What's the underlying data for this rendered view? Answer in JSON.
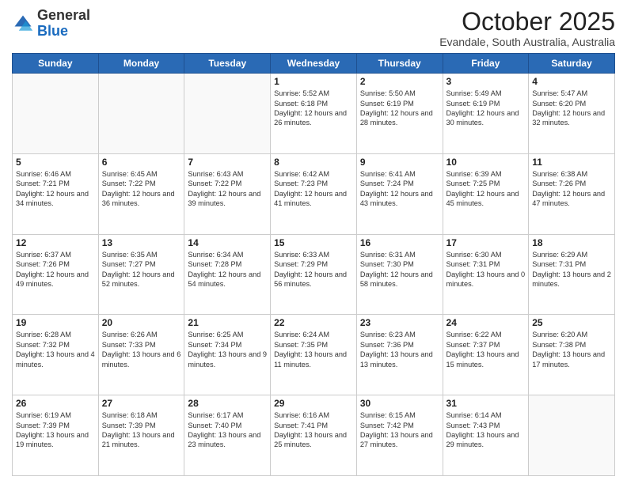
{
  "logo": {
    "general": "General",
    "blue": "Blue"
  },
  "header": {
    "month": "October 2025",
    "location": "Evandale, South Australia, Australia"
  },
  "weekdays": [
    "Sunday",
    "Monday",
    "Tuesday",
    "Wednesday",
    "Thursday",
    "Friday",
    "Saturday"
  ],
  "weeks": [
    [
      {
        "day": "",
        "info": ""
      },
      {
        "day": "",
        "info": ""
      },
      {
        "day": "",
        "info": ""
      },
      {
        "day": "1",
        "info": "Sunrise: 5:52 AM\nSunset: 6:18 PM\nDaylight: 12 hours\nand 26 minutes."
      },
      {
        "day": "2",
        "info": "Sunrise: 5:50 AM\nSunset: 6:19 PM\nDaylight: 12 hours\nand 28 minutes."
      },
      {
        "day": "3",
        "info": "Sunrise: 5:49 AM\nSunset: 6:19 PM\nDaylight: 12 hours\nand 30 minutes."
      },
      {
        "day": "4",
        "info": "Sunrise: 5:47 AM\nSunset: 6:20 PM\nDaylight: 12 hours\nand 32 minutes."
      }
    ],
    [
      {
        "day": "5",
        "info": "Sunrise: 6:46 AM\nSunset: 7:21 PM\nDaylight: 12 hours\nand 34 minutes."
      },
      {
        "day": "6",
        "info": "Sunrise: 6:45 AM\nSunset: 7:22 PM\nDaylight: 12 hours\nand 36 minutes."
      },
      {
        "day": "7",
        "info": "Sunrise: 6:43 AM\nSunset: 7:22 PM\nDaylight: 12 hours\nand 39 minutes."
      },
      {
        "day": "8",
        "info": "Sunrise: 6:42 AM\nSunset: 7:23 PM\nDaylight: 12 hours\nand 41 minutes."
      },
      {
        "day": "9",
        "info": "Sunrise: 6:41 AM\nSunset: 7:24 PM\nDaylight: 12 hours\nand 43 minutes."
      },
      {
        "day": "10",
        "info": "Sunrise: 6:39 AM\nSunset: 7:25 PM\nDaylight: 12 hours\nand 45 minutes."
      },
      {
        "day": "11",
        "info": "Sunrise: 6:38 AM\nSunset: 7:26 PM\nDaylight: 12 hours\nand 47 minutes."
      }
    ],
    [
      {
        "day": "12",
        "info": "Sunrise: 6:37 AM\nSunset: 7:26 PM\nDaylight: 12 hours\nand 49 minutes."
      },
      {
        "day": "13",
        "info": "Sunrise: 6:35 AM\nSunset: 7:27 PM\nDaylight: 12 hours\nand 52 minutes."
      },
      {
        "day": "14",
        "info": "Sunrise: 6:34 AM\nSunset: 7:28 PM\nDaylight: 12 hours\nand 54 minutes."
      },
      {
        "day": "15",
        "info": "Sunrise: 6:33 AM\nSunset: 7:29 PM\nDaylight: 12 hours\nand 56 minutes."
      },
      {
        "day": "16",
        "info": "Sunrise: 6:31 AM\nSunset: 7:30 PM\nDaylight: 12 hours\nand 58 minutes."
      },
      {
        "day": "17",
        "info": "Sunrise: 6:30 AM\nSunset: 7:31 PM\nDaylight: 13 hours\nand 0 minutes."
      },
      {
        "day": "18",
        "info": "Sunrise: 6:29 AM\nSunset: 7:31 PM\nDaylight: 13 hours\nand 2 minutes."
      }
    ],
    [
      {
        "day": "19",
        "info": "Sunrise: 6:28 AM\nSunset: 7:32 PM\nDaylight: 13 hours\nand 4 minutes."
      },
      {
        "day": "20",
        "info": "Sunrise: 6:26 AM\nSunset: 7:33 PM\nDaylight: 13 hours\nand 6 minutes."
      },
      {
        "day": "21",
        "info": "Sunrise: 6:25 AM\nSunset: 7:34 PM\nDaylight: 13 hours\nand 9 minutes."
      },
      {
        "day": "22",
        "info": "Sunrise: 6:24 AM\nSunset: 7:35 PM\nDaylight: 13 hours\nand 11 minutes."
      },
      {
        "day": "23",
        "info": "Sunrise: 6:23 AM\nSunset: 7:36 PM\nDaylight: 13 hours\nand 13 minutes."
      },
      {
        "day": "24",
        "info": "Sunrise: 6:22 AM\nSunset: 7:37 PM\nDaylight: 13 hours\nand 15 minutes."
      },
      {
        "day": "25",
        "info": "Sunrise: 6:20 AM\nSunset: 7:38 PM\nDaylight: 13 hours\nand 17 minutes."
      }
    ],
    [
      {
        "day": "26",
        "info": "Sunrise: 6:19 AM\nSunset: 7:39 PM\nDaylight: 13 hours\nand 19 minutes."
      },
      {
        "day": "27",
        "info": "Sunrise: 6:18 AM\nSunset: 7:39 PM\nDaylight: 13 hours\nand 21 minutes."
      },
      {
        "day": "28",
        "info": "Sunrise: 6:17 AM\nSunset: 7:40 PM\nDaylight: 13 hours\nand 23 minutes."
      },
      {
        "day": "29",
        "info": "Sunrise: 6:16 AM\nSunset: 7:41 PM\nDaylight: 13 hours\nand 25 minutes."
      },
      {
        "day": "30",
        "info": "Sunrise: 6:15 AM\nSunset: 7:42 PM\nDaylight: 13 hours\nand 27 minutes."
      },
      {
        "day": "31",
        "info": "Sunrise: 6:14 AM\nSunset: 7:43 PM\nDaylight: 13 hours\nand 29 minutes."
      },
      {
        "day": "",
        "info": ""
      }
    ]
  ]
}
